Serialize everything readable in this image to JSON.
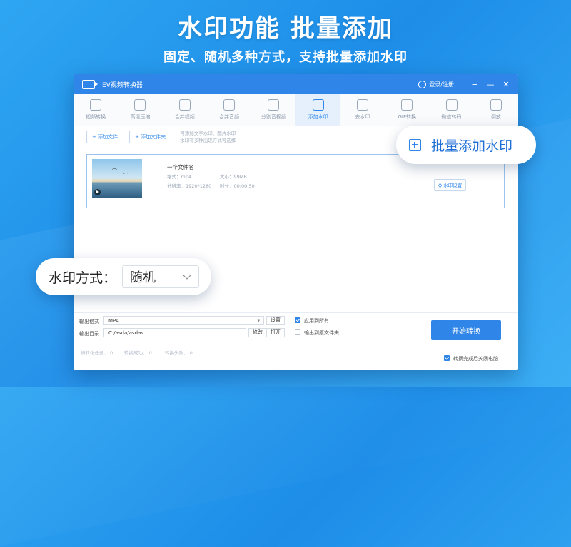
{
  "headline": {
    "title": "水印功能  批量添加",
    "subtitle": "固定、随机多种方式，支持批量添加水印"
  },
  "window": {
    "title": "EV视频转换器",
    "login": "登录/注册"
  },
  "tools": [
    {
      "label": "视频转换",
      "icon": "convert-icon"
    },
    {
      "label": "高清压缩",
      "icon": "compress-icon"
    },
    {
      "label": "合并视频",
      "icon": "merge-video-icon"
    },
    {
      "label": "合并音频",
      "icon": "merge-audio-icon"
    },
    {
      "label": "分割音视频",
      "icon": "split-icon"
    },
    {
      "label": "添加水印",
      "icon": "watermark-icon",
      "active": true
    },
    {
      "label": "去水印",
      "icon": "remove-watermark-icon"
    },
    {
      "label": "GIF转换",
      "icon": "gif-icon"
    },
    {
      "label": "微信转码",
      "icon": "wechat-icon"
    },
    {
      "label": "倒放",
      "icon": "reverse-icon"
    }
  ],
  "actions": {
    "add_file": "+ 添加文件",
    "add_folder": "+ 添加文件夹",
    "hint_line1": "可添加文字水印、图片水印",
    "hint_line2": "水印有多种出现方式可选择"
  },
  "file": {
    "name": "一个文件名",
    "format_label": "格式：",
    "format_value": "mp4",
    "size_label": "大小：",
    "size_value": "99MB",
    "resolution_label": "分辨率：",
    "resolution_value": "1920*1280",
    "duration_label": "时长：",
    "duration_value": "00:00:50",
    "settings_button": "水印设置"
  },
  "bottom": {
    "output_format_label": "输出格式",
    "output_format_value": "MP4",
    "settings_button": "设置",
    "apply_all": "应用到所有",
    "output_dir_label": "输出目录",
    "output_dir_value": "C:/asda/asdas",
    "modify_button": "修改",
    "open_button": "打开",
    "output_original": "输出到原文件夹",
    "start_button": "开始转换",
    "stat_pending": "待转化任务：  0",
    "stat_success": "转换成功：  0",
    "stat_fail": "转换失败：  0",
    "shutdown": "转换完成后关闭电脑"
  },
  "callouts": {
    "batch": "批量添加水印",
    "mode_label": "水印方式：",
    "mode_value": "随机"
  },
  "colors": {
    "primary": "#2f86e8",
    "background": "#2397ec"
  }
}
